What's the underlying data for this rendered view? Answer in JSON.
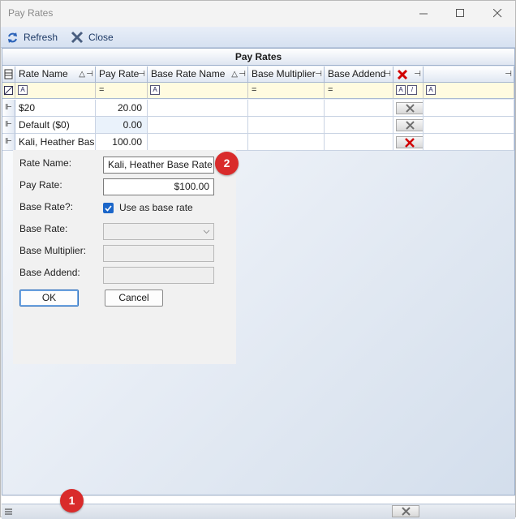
{
  "window": {
    "title": "Pay Rates",
    "minimize_icon": "minimize-icon",
    "maximize_icon": "maximize-icon",
    "close_icon": "close-icon"
  },
  "toolbar": {
    "refresh_label": "Refresh",
    "close_label": "Close"
  },
  "grid": {
    "caption": "Pay Rates",
    "columns": [
      {
        "label": "Rate Name"
      },
      {
        "label": "Pay Rate"
      },
      {
        "label": "Base Rate Name"
      },
      {
        "label": "Base Multiplier"
      },
      {
        "label": "Base Addend"
      }
    ],
    "filter_ops": {
      "eq": "="
    },
    "rows": [
      {
        "rate_name": "$20",
        "pay_rate": "20.00"
      },
      {
        "rate_name": "Default ($0)",
        "pay_rate": "0.00"
      },
      {
        "rate_name": "Kali, Heather Bas",
        "pay_rate": "100.00"
      }
    ]
  },
  "form": {
    "rate_name_label": "Rate Name:",
    "rate_name_value": "Kali, Heather Base Rate",
    "pay_rate_label": "Pay Rate:",
    "pay_rate_value": "$100.00",
    "base_rate_q_label": "Base Rate?:",
    "use_as_base_label": "Use as base rate",
    "base_rate_label": "Base Rate:",
    "base_multiplier_label": "Base Multiplier:",
    "base_addend_label": "Base Addend:",
    "ok_label": "OK",
    "cancel_label": "Cancel"
  },
  "badges": {
    "one": "1",
    "two": "2"
  },
  "colors": {
    "accent": "#1b66c9",
    "badge": "#d92b2b",
    "delete_red": "#d10000"
  }
}
